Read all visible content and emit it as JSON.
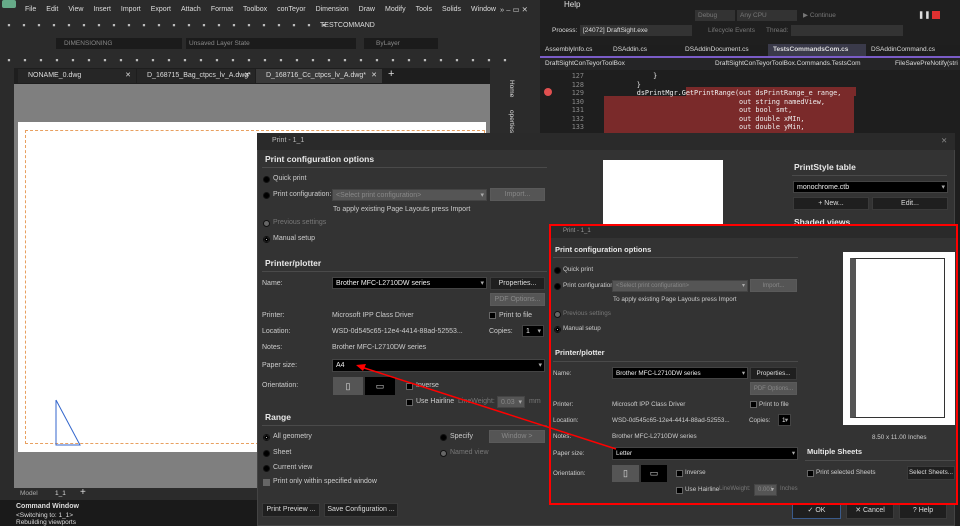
{
  "draftsight": {
    "menu": [
      "File",
      "Edit",
      "View",
      "Insert",
      "Import",
      "Export",
      "Attach",
      "Format",
      "Toolbox",
      "conTeyor",
      "Dimension",
      "Draw",
      "Modify",
      "Tools",
      "Solids",
      "Window"
    ],
    "command_label": "TESTCOMMAND",
    "layer": "DIMENSIONING",
    "layer_state": "Unsaved Layer State",
    "color": "ByLayer",
    "doc_tabs": [
      "NONAME_0.dwg",
      "D_168715_Bag_ctpcs_lv_A.dwg*",
      "D_168716_Cc_ctpcs_lv_A.dwg*"
    ],
    "dock_tabs": [
      "Home",
      "operties"
    ],
    "layout_tabs": [
      "Model",
      "1_1"
    ],
    "command_window": {
      "title": "Command Window",
      "lines": [
        "<Switching to: 1_1>",
        "Rebuilding viewports"
      ]
    }
  },
  "vs": {
    "help": "Help",
    "config": "Debug",
    "platform": "Any CPU",
    "continue": "Continue",
    "process_label": "Process:",
    "process": "[24072] DraftSight.exe",
    "lifecycle": "Lifecycle Events",
    "thread": "Thread:",
    "tabs": [
      "AssemblyInfo.cs",
      "DSAddin.cs",
      "DSAddinDocument.cs",
      "TestsCommandsCom.cs",
      "DSAddinCommand.cs"
    ],
    "nav": [
      "DraftSightConTeyorToolBox",
      "DraftSightConTeyorToolBox.Commands.TestsCom",
      "FileSavePreNotify(stri"
    ],
    "lines": [
      {
        "n": "127",
        "t": "            }"
      },
      {
        "n": "128",
        "t": "        }"
      },
      {
        "n": "129",
        "t": "        dsPrintMgr.GetPrintRange(out dsPrintRange_e range,"
      },
      {
        "n": "130",
        "t": "                                 out string namedView,"
      },
      {
        "n": "131",
        "t": "                                 out bool smt,"
      },
      {
        "n": "132",
        "t": "                                 out double xMIn,"
      },
      {
        "n": "133",
        "t": "                                 out double yMin,"
      }
    ]
  },
  "dialog": {
    "title": "Print - 1_1",
    "config_header": "Print configuration options",
    "quick_print": "Quick print",
    "print_config": "Print configuration:",
    "select_config": "<Select print configuration>",
    "import": "Import...",
    "hint": "To apply existing Page Layouts press Import",
    "previous": "Previous settings",
    "manual": "Manual setup",
    "printer_header": "Printer/plotter",
    "name_label": "Name:",
    "name": "Brother MFC-L2710DW series",
    "properties": "Properties...",
    "pdf": "PDF Options...",
    "printer_label": "Printer:",
    "printer": "Microsoft IPP Class Driver",
    "print_to_file": "Print to file",
    "location_label": "Location:",
    "location": "WSD-0d545c65-12e4-4414-88ad-52553...",
    "copies_label": "Copies:",
    "copies": "1",
    "notes_label": "Notes:",
    "notes": "Brother MFC-L2710DW series",
    "paper_label": "Paper size:",
    "paper": "A4",
    "orientation_label": "Orientation:",
    "inverse": "Inverse",
    "hairline": "Use Hairline",
    "lineweight_label": "LineWeight:",
    "lineweight": "0.03",
    "unit": "mm",
    "range_header": "Range",
    "all_geometry": "All geometry",
    "sheet": "Sheet",
    "current_view": "Current view",
    "specify": "Specify",
    "window": "Window >",
    "named_view": "Named view",
    "print_only": "Print only within specified window",
    "preview_btn": "Print Preview ...",
    "save_btn": "Save Configuration ...",
    "style_header": "PrintStyle table",
    "style": "monochrome.ctb",
    "new": "+ New...",
    "edit": "Edit...",
    "shaded": "Shaded views",
    "ok": "✓ OK",
    "cancel": "✕ Cancel",
    "help": "? Help"
  },
  "dialog2": {
    "title": "Print - 1_1",
    "paper": "Letter",
    "lineweight": "0.001",
    "unit": "Inches",
    "paper_dims": "8.50 x 11.00 Inches",
    "multi_header": "Multiple Sheets",
    "print_selected": "Print selected Sheets",
    "select_sheets": "Select Sheets..."
  },
  "colors": {
    "highlight": "#ff0000",
    "breakpoint": "#e05050",
    "code_bg": "#7a2a2a",
    "accent": "#7a5cc7"
  }
}
